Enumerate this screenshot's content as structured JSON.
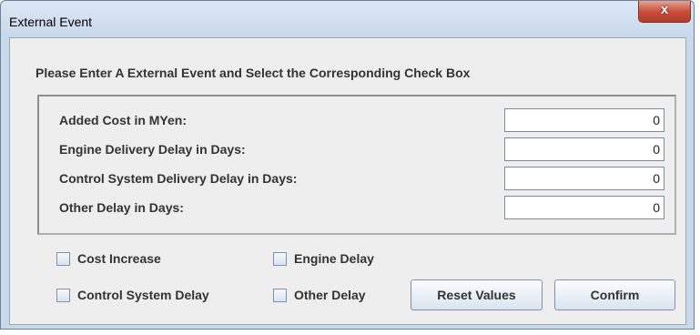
{
  "window": {
    "title": "External Event",
    "close_glyph": "x"
  },
  "prompt": "Please Enter A External Event and Select the Corresponding Check Box",
  "fields": [
    {
      "label": "Added Cost in MYen:",
      "value": "0"
    },
    {
      "label": "Engine Delivery Delay in Days:",
      "value": "0"
    },
    {
      "label": "Control System Delivery Delay in Days:",
      "value": "0"
    },
    {
      "label": "Other Delay in Days:",
      "value": "0"
    }
  ],
  "checkboxes": {
    "cost_increase": {
      "label": "Cost Increase",
      "checked": false
    },
    "engine_delay": {
      "label": "Engine Delay",
      "checked": false
    },
    "control_system_delay": {
      "label": "Control System Delay",
      "checked": false
    },
    "other_delay": {
      "label": "Other Delay",
      "checked": false
    }
  },
  "buttons": {
    "reset": "Reset Values",
    "confirm": "Confirm"
  },
  "colors": {
    "frame": "#c9d9ec",
    "content": "#eeeeee",
    "close": "#c8503c"
  },
  "icons": {
    "close": "close-icon"
  }
}
